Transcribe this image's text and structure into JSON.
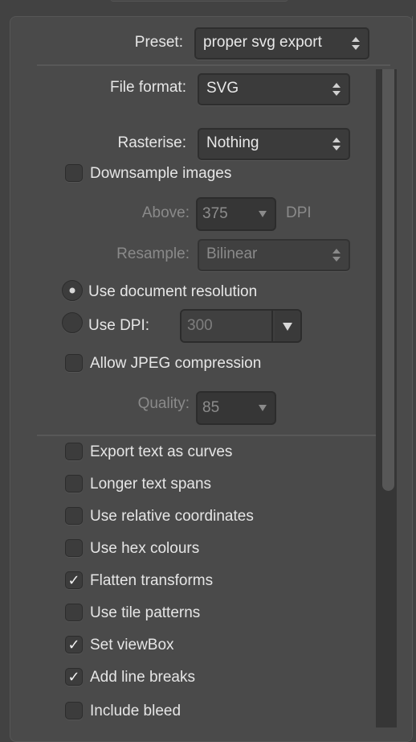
{
  "preset": {
    "label": "Preset:",
    "value": "proper svg export"
  },
  "file_format": {
    "label": "File format:",
    "value": "SVG"
  },
  "rasterise": {
    "label": "Rasterise:",
    "value": "Nothing"
  },
  "downsample_images": {
    "label": "Downsample images",
    "checked": false
  },
  "above": {
    "label": "Above:",
    "value": "375",
    "unit": "DPI",
    "enabled": false
  },
  "resample": {
    "label": "Resample:",
    "value": "Bilinear",
    "enabled": false
  },
  "resolution_mode": {
    "options": [
      {
        "label": "Use document resolution",
        "selected": true
      },
      {
        "label": "Use DPI:",
        "selected": false
      }
    ],
    "dpi_value": "300"
  },
  "allow_jpeg": {
    "label": "Allow JPEG compression",
    "checked": false
  },
  "quality": {
    "label": "Quality:",
    "value": "85",
    "enabled": false
  },
  "options": [
    {
      "label": "Export text as curves",
      "checked": false,
      "mark": ""
    },
    {
      "label": "Longer text spans",
      "checked": false,
      "mark": ""
    },
    {
      "label": "Use relative coordinates",
      "checked": false,
      "mark": ""
    },
    {
      "label": "Use hex colours",
      "checked": false,
      "mark": ""
    },
    {
      "label": "Flatten transforms",
      "checked": true,
      "mark": "✓"
    },
    {
      "label": "Use tile patterns",
      "checked": false,
      "mark": ""
    },
    {
      "label": "Set viewBox",
      "checked": true,
      "mark": "✓"
    },
    {
      "label": "Add line breaks",
      "checked": true,
      "mark": "✓"
    },
    {
      "label": "Include bleed",
      "checked": false,
      "mark": ""
    }
  ],
  "scrollbar": {
    "position_fraction": 0.0,
    "visible_fraction": 0.64
  }
}
